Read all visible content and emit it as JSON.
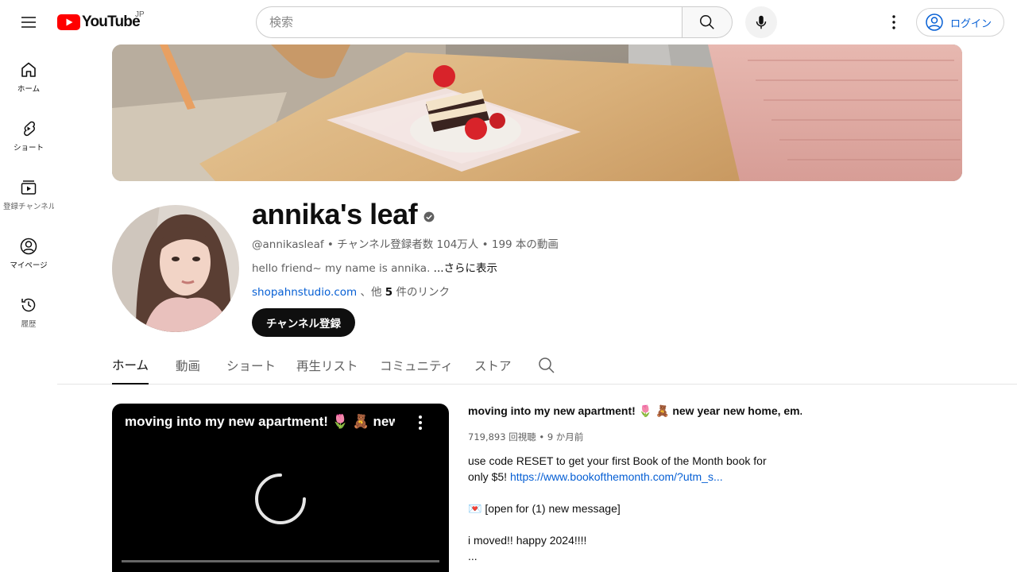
{
  "masthead": {
    "logo_text": "YouTube",
    "region": "JP",
    "search_placeholder": "検索",
    "login_label": "ログイン"
  },
  "guide": {
    "items": [
      {
        "label": "ホーム",
        "icon": "home-icon"
      },
      {
        "label": "ショート",
        "icon": "shorts-icon"
      },
      {
        "label": "登録チャンネル",
        "icon": "subscriptions-icon"
      },
      {
        "label": "マイページ",
        "icon": "account-icon"
      },
      {
        "label": "履歴",
        "icon": "history-icon"
      }
    ]
  },
  "channel": {
    "name": "annika's leaf",
    "handle": "@annikasleaf",
    "separator": " • ",
    "subscribers": "チャンネル登録者数 104万人",
    "videos": "199 本の動画",
    "description": "hello friend~ my name is annika. ",
    "more_label": "...さらに表示",
    "link_url": "shopahnstudio.com",
    "links_middle": " 、他 ",
    "links_count": "5",
    "links_suffix": " 件のリンク",
    "subscribe_label": "チャンネル登録"
  },
  "tabs": [
    {
      "label": "ホーム",
      "active": true
    },
    {
      "label": "動画",
      "active": false
    },
    {
      "label": "ショート",
      "active": false
    },
    {
      "label": "再生リスト",
      "active": false
    },
    {
      "label": "コミュニティ",
      "active": false
    },
    {
      "label": "ストア",
      "active": false
    }
  ],
  "featured": {
    "player_title": "moving into my new apartment! 🌷 🧸 new year new home, em...",
    "title": "moving into my new apartment! 🌷 🧸 new year new home, em...",
    "views": "719,893 回視聴",
    "age": "9 か月前",
    "desc_line1": "use code RESET to get your first Book of the Month book for",
    "desc_line2_pre": "only $5! ",
    "desc_link": "https://www.bookofthemonth.com/?utm_s...",
    "desc_line3": "💌 [open for (1) new message]",
    "desc_line4": "i moved!! happy 2024!!!!",
    "desc_line5": "..."
  },
  "colors": {
    "brand_red": "#ff0000",
    "link_blue": "#065fd4",
    "text_primary": "#0f0f0f",
    "text_secondary": "#606060"
  }
}
